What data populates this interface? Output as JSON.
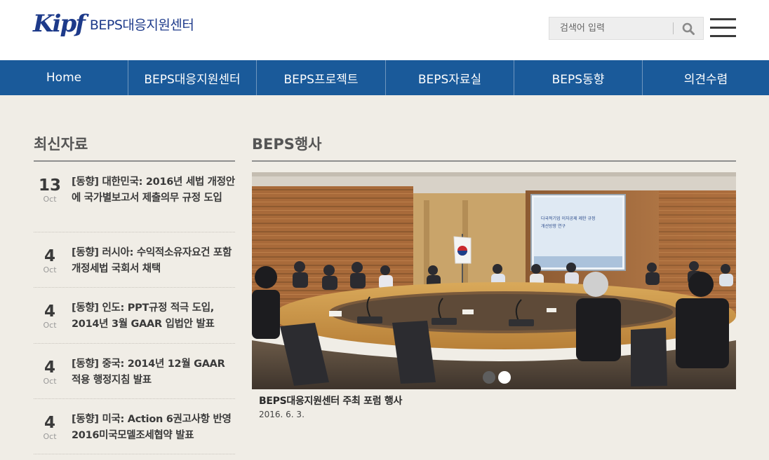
{
  "header": {
    "logo_mark": "Kipf",
    "logo_text": "BEPS대응지원센터",
    "search_placeholder": "검색어 입력"
  },
  "nav": {
    "items": [
      {
        "label": "Home"
      },
      {
        "label": "BEPS대응지원센터"
      },
      {
        "label": "BEPS프로젝트"
      },
      {
        "label": "BEPS자료실"
      },
      {
        "label": "BEPS동향"
      },
      {
        "label": "의견수렴"
      }
    ]
  },
  "latest": {
    "title": "최신자료",
    "items": [
      {
        "day": "13",
        "month": "Oct",
        "title": "[동향] 대한민국: 2016년 세법 개정안에 국가별보고서 제출의무 규정 도입"
      },
      {
        "day": "4",
        "month": "Oct",
        "title": "[동향] 러시아: 수익적소유자요건 포함 개정세법 국회서 채택"
      },
      {
        "day": "4",
        "month": "Oct",
        "title": "[동향] 인도: PPT규정 적극 도입, 2014년 3월 GAAR 입법안 발표"
      },
      {
        "day": "4",
        "month": "Oct",
        "title": "[동향] 중국: 2014년 12월 GAAR 적용 행정지침 발표"
      },
      {
        "day": "4",
        "month": "Oct",
        "title": "[동향] 미국: Action 6권고사항 반영 2016미국모델조세협약 발표"
      }
    ]
  },
  "events": {
    "title": "BEPS행사",
    "screen_line1": "다국적기업 이자공제 제한 규정",
    "screen_line2": "개선방향 연구",
    "caption_title": "BEPS대응지원센터 주최 포럼 행사",
    "caption_date": "2016. 6. 3."
  },
  "colors": {
    "nav_bg": "#1a5a9a",
    "page_bg": "#f0ede6",
    "logo_blue": "#1d3a8a"
  }
}
